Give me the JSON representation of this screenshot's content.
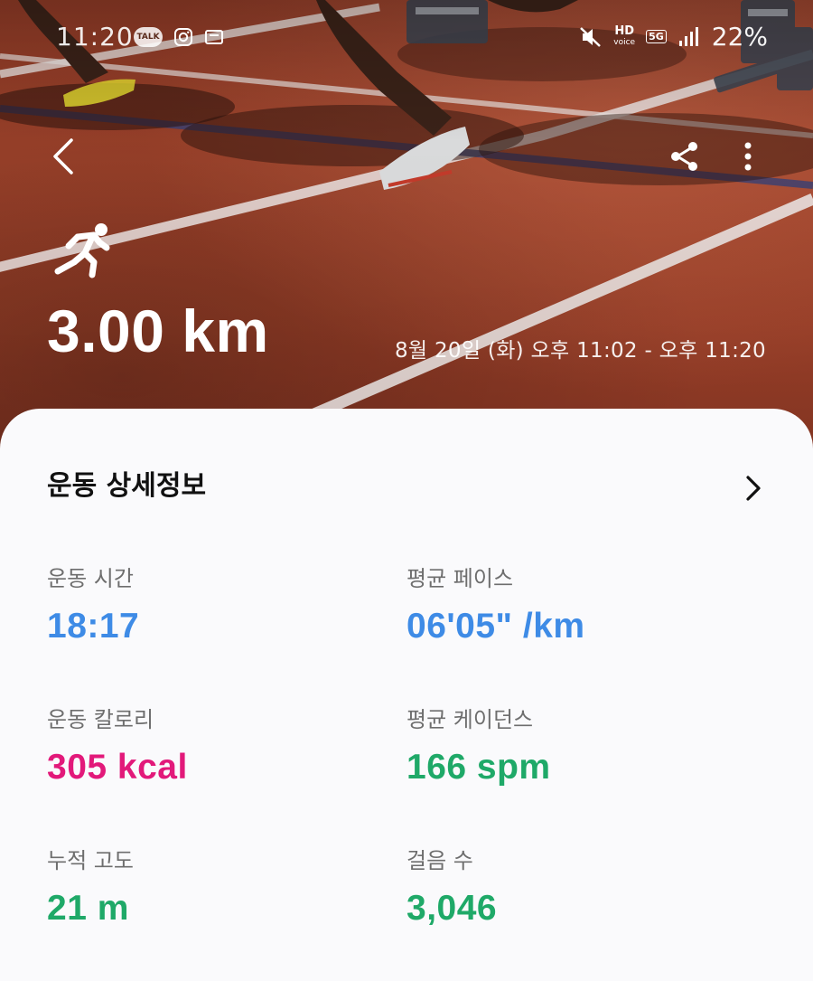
{
  "status_bar": {
    "time": "11:20",
    "talk_badge": "TALK",
    "hd_label": "HD",
    "voice_label": "voice",
    "network_label": "5G",
    "battery": "22%"
  },
  "hero": {
    "distance": "3.00 km",
    "time_range": "8월 20일 (화) 오후 11:02 - 오후 11:20"
  },
  "details": {
    "title": "운동 상세정보",
    "metrics": [
      {
        "label": "운동 시간",
        "value": "18:17",
        "color": "#3e8be6"
      },
      {
        "label": "평균 페이스",
        "value": "06'05\" /km",
        "color": "#3e8be6"
      },
      {
        "label": "운동 칼로리",
        "value": "305 kcal",
        "color": "#e2197a"
      },
      {
        "label": "평균 케이던스",
        "value": "166 spm",
        "color": "#1fa968"
      },
      {
        "label": "누적 고도",
        "value": "21 m",
        "color": "#1fa968"
      },
      {
        "label": "걸음 수",
        "value": "3,046",
        "color": "#1fa968"
      }
    ]
  },
  "icons": {
    "back": "chevron-left-icon",
    "share": "share-icon",
    "more": "more-vertical-icon",
    "activity": "running-icon",
    "details_open": "chevron-right-icon"
  }
}
